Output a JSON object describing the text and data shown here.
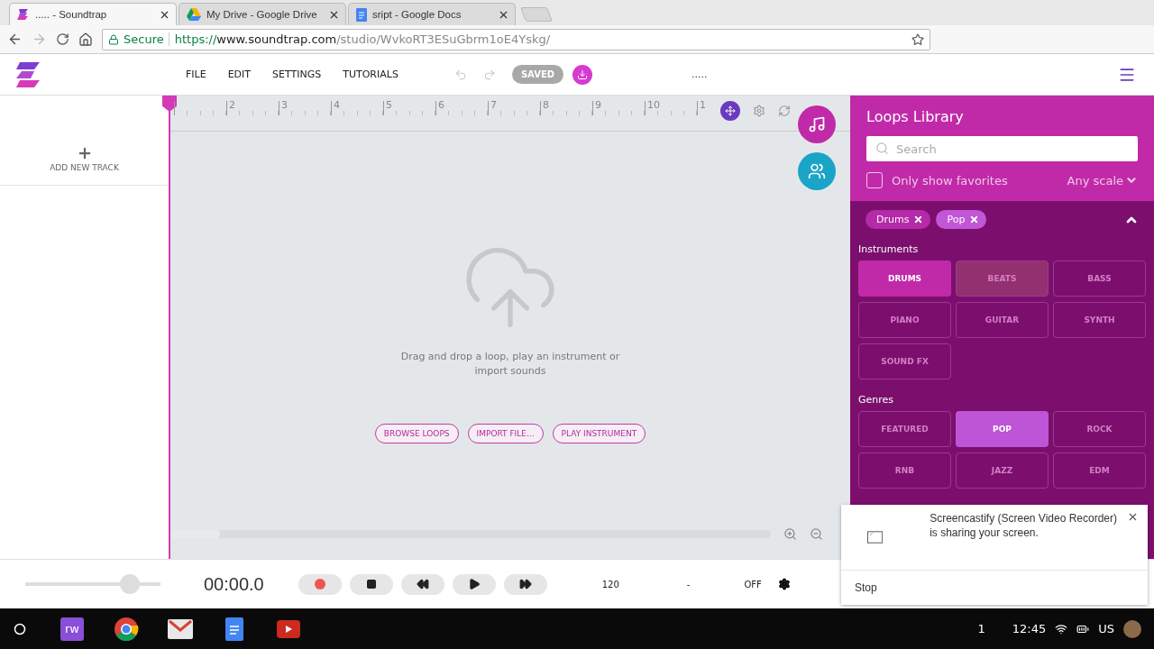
{
  "browser": {
    "tabs": [
      {
        "title": "..... - Soundtrap",
        "selected": true,
        "kind": "soundtrap"
      },
      {
        "title": "My Drive - Google Drive",
        "selected": false,
        "kind": "drive"
      },
      {
        "title": "sript - Google Docs",
        "selected": false,
        "kind": "docs"
      }
    ],
    "address": {
      "secure_label": "Secure",
      "scheme": "https://",
      "host": "www.soundtrap.com",
      "path": "/studio/WvkoRT3ESuGbrm1oE4Yskg/"
    }
  },
  "app_header": {
    "menu": [
      "FILE",
      "EDIT",
      "SETTINGS",
      "TUTORIALS"
    ],
    "saved_label": "SAVED",
    "project_title": "....."
  },
  "tracks": {
    "add_label": "ADD NEW TRACK"
  },
  "timeline": {
    "ruler": [
      "2",
      "3",
      "4",
      "5",
      "6",
      "7",
      "8",
      "9",
      "10",
      "1"
    ],
    "empty_message": "Drag and drop a loop, play an instrument or import sounds",
    "actions": [
      "BROWSE LOOPS",
      "IMPORT FILE...",
      "PLAY INSTRUMENT"
    ]
  },
  "loops_library": {
    "title": "Loops Library",
    "search": {
      "placeholder": "Search"
    },
    "favorites": {
      "label": "Only show favorites",
      "checked": false
    },
    "scale": "Any scale",
    "filters": [
      {
        "label": "Drums",
        "color": "#b52aa8"
      },
      {
        "label": "Pop",
        "color": "#c156d6"
      }
    ],
    "instruments_heading": "Instruments",
    "instruments": [
      {
        "label": "DRUMS",
        "selected": true,
        "hovered": false
      },
      {
        "label": "BEATS",
        "selected": false,
        "hovered": true
      },
      {
        "label": "BASS",
        "selected": false,
        "hovered": false
      },
      {
        "label": "PIANO",
        "selected": false,
        "hovered": false
      },
      {
        "label": "GUITAR",
        "selected": false,
        "hovered": false
      },
      {
        "label": "SYNTH",
        "selected": false,
        "hovered": false
      },
      {
        "label": "SOUND FX",
        "selected": false,
        "hovered": false
      }
    ],
    "genres_heading": "Genres",
    "genres": [
      {
        "label": "FEATURED",
        "selected": false
      },
      {
        "label": "POP",
        "selected": true
      },
      {
        "label": "ROCK",
        "selected": false
      },
      {
        "label": "RNB",
        "selected": false
      },
      {
        "label": "JAZZ",
        "selected": false
      },
      {
        "label": "EDM",
        "selected": false
      }
    ]
  },
  "transport": {
    "volume": {
      "level": 0.77
    },
    "time": "00:00.0",
    "tempo": "120",
    "key": "-",
    "metronome": "OFF"
  },
  "notification": {
    "message": "Screencastify (Screen Video Recorder) is sharing your screen.",
    "action": "Stop"
  },
  "taskbar": {
    "apps": [
      {
        "kind": "rw",
        "label": "rw"
      },
      {
        "kind": "chrome"
      },
      {
        "kind": "gmail"
      },
      {
        "kind": "docs"
      },
      {
        "kind": "youtube"
      }
    ],
    "badge": "1",
    "clock": "12:45",
    "locale": "US"
  }
}
